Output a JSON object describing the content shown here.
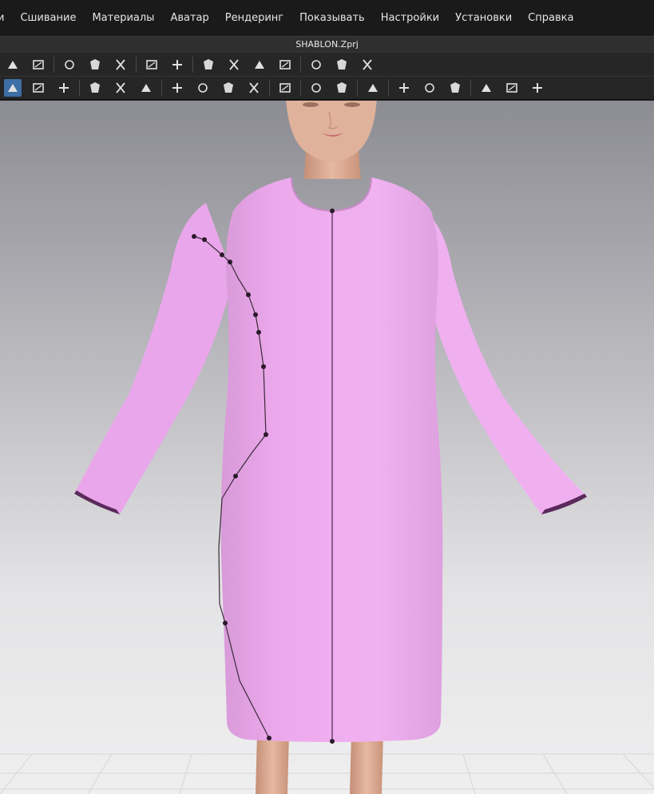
{
  "menu": {
    "items": [
      "и",
      "Сшивание",
      "Материалы",
      "Аватар",
      "Рендеринг",
      "Показывать",
      "Настройки",
      "Установки",
      "Справка"
    ]
  },
  "window": {
    "title": "SHABLON.Zprj"
  },
  "toolbar1": {
    "tools": [
      {
        "name": "transform-pattern-icon"
      },
      {
        "name": "edit-pattern-icon"
      },
      {
        "name": "sep"
      },
      {
        "name": "edit-curve-point-icon"
      },
      {
        "name": "segment-sewing-icon"
      },
      {
        "name": "free-sewing-icon"
      },
      {
        "name": "sep"
      },
      {
        "name": "garment-icon"
      },
      {
        "name": "garment-fit-icon"
      },
      {
        "name": "sep"
      },
      {
        "name": "tack-icon"
      },
      {
        "name": "tape-icon"
      },
      {
        "name": "pin-icon"
      },
      {
        "name": "fold-arrangement-icon"
      },
      {
        "name": "sep"
      },
      {
        "name": "measure-icon"
      },
      {
        "name": "ring-icon"
      },
      {
        "name": "ruler-icon"
      }
    ]
  },
  "toolbar2": {
    "tools": [
      {
        "name": "select-move-icon",
        "active": true
      },
      {
        "name": "edit-avatar-icon"
      },
      {
        "name": "avatar-fit-icon"
      },
      {
        "name": "sep"
      },
      {
        "name": "texture-icon"
      },
      {
        "name": "graphic-icon"
      },
      {
        "name": "topstitch-icon"
      },
      {
        "name": "sep"
      },
      {
        "name": "button-icon"
      },
      {
        "name": "buttonhole-icon"
      },
      {
        "name": "line-icon"
      },
      {
        "name": "lock-icon"
      },
      {
        "name": "sep"
      },
      {
        "name": "zipper-icon"
      },
      {
        "name": "sep"
      },
      {
        "name": "puckering-icon"
      },
      {
        "name": "elastic-icon"
      },
      {
        "name": "sep"
      },
      {
        "name": "split-icon"
      },
      {
        "name": "sep"
      },
      {
        "name": "shirring-icon"
      },
      {
        "name": "piping-icon"
      },
      {
        "name": "fold-icon"
      },
      {
        "name": "sep"
      },
      {
        "name": "garment-front-icon"
      },
      {
        "name": "garment-back-icon"
      },
      {
        "name": "garment-reset-icon"
      }
    ]
  },
  "viewport": {
    "garment_color": "#eca8ec",
    "background_top": "#8c8d93",
    "background_bottom": "#efeff0"
  }
}
